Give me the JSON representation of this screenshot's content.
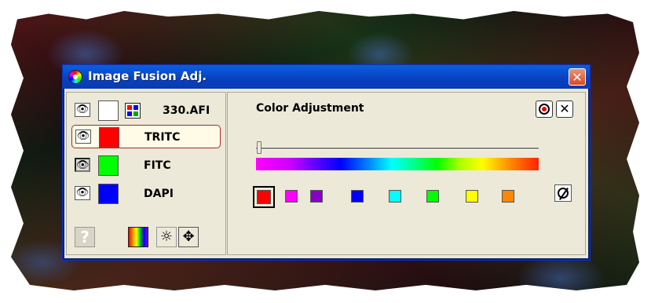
{
  "window": {
    "title": "Image Fusion Adj.",
    "close_label": "✕"
  },
  "channels": [
    {
      "label": "330.AFI",
      "color": "#ffffff",
      "visible": true,
      "eye_icon": "eye-icon"
    },
    {
      "label": "TRITC",
      "color": "#ff0000",
      "visible": true,
      "eye_icon": "eye-icon",
      "selected": true
    },
    {
      "label": "FITC",
      "color": "#00ff00",
      "visible": false,
      "eye_icon": "eye-icon"
    },
    {
      "label": "DAPI",
      "color": "#0000ff",
      "visible": true,
      "eye_icon": "eye-icon"
    }
  ],
  "tools": {
    "undo_glyph": "?",
    "brightness_glyph": "☼",
    "move_glyph": "✥"
  },
  "color_adjustment": {
    "title": "Color Adjustment",
    "close_label": "✕",
    "slider_value": 0,
    "preset_colors": [
      "#ff0000",
      "#ff00ff",
      "#8800cc",
      "#0000ff",
      "#00ffff",
      "#00ff00",
      "#ffff00",
      "#ff8800"
    ],
    "selected_preset": 0
  }
}
